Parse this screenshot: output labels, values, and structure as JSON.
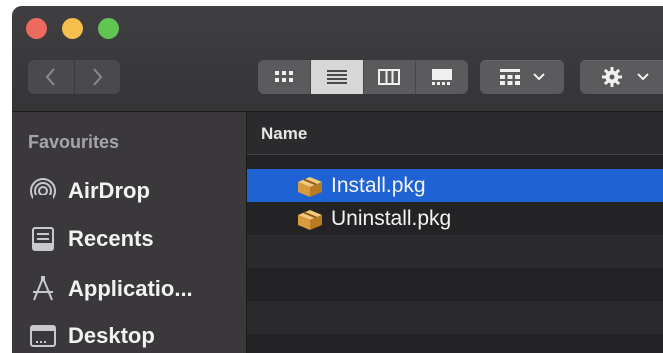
{
  "window": {
    "traffic_lights": {
      "close_color": "#ed6a5e",
      "minimize_color": "#f4bf4f",
      "zoom_color": "#61c554"
    }
  },
  "toolbar": {
    "back_icon": "chevron-left-icon",
    "forward_icon": "chevron-right-icon",
    "view_modes": [
      "icon-view",
      "list-view",
      "column-view",
      "gallery-view"
    ],
    "active_view": "list-view",
    "group_icon": "group-by-icon",
    "action_icon": "gear-icon"
  },
  "sidebar": {
    "heading": "Favourites",
    "items": [
      {
        "label": "AirDrop",
        "icon": "airdrop-icon"
      },
      {
        "label": "Recents",
        "icon": "recents-icon"
      },
      {
        "label": "Applicatio...",
        "icon": "applications-icon"
      },
      {
        "label": "Desktop",
        "icon": "desktop-icon"
      }
    ]
  },
  "file_list": {
    "column_header": "Name",
    "files": [
      {
        "name": "Install.pkg",
        "selected": true
      },
      {
        "name": "Uninstall.pkg",
        "selected": false
      }
    ],
    "selection_color": "#1f62d4"
  }
}
